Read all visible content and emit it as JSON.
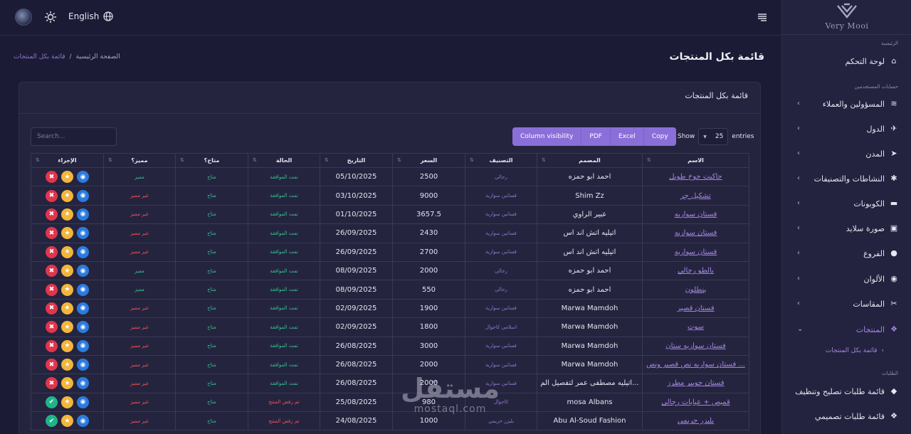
{
  "header": {
    "language": "English",
    "page_title": "قائمة بكل المنتجات",
    "breadcrumb": {
      "home": "الصفحة الرئيسية",
      "current": "قائمة بكل المنتجات",
      "separator": "/"
    }
  },
  "sidebar": {
    "logo_text": "Very Mooi",
    "sections": {
      "main": "الرئيسية",
      "users": "حسابات المستخدمين",
      "orders": "الطلبات"
    },
    "items": [
      {
        "label": "لوحة التحكم",
        "icon": "home-icon"
      },
      {
        "label": "المسؤولين والعملاء",
        "icon": "layers-icon"
      },
      {
        "label": "الدول",
        "icon": "plane-icon"
      },
      {
        "label": "المدن",
        "icon": "send-icon"
      },
      {
        "label": "النشاطات والتصنيفات",
        "icon": "gear-icon"
      },
      {
        "label": "الكوبونات",
        "icon": "ticket-icon"
      },
      {
        "label": "صورة سلايد",
        "icon": "image-icon"
      },
      {
        "label": "الفروع",
        "icon": "map-pin-icon"
      },
      {
        "label": "الألوان",
        "icon": "palette-icon"
      },
      {
        "label": "المقاسات",
        "icon": "scissors-icon"
      },
      {
        "label": "المنتجات",
        "icon": "cubes-icon"
      },
      {
        "label": "قائمة طلبات تصليح وتنظيف",
        "icon": "box-icon"
      },
      {
        "label": "قائمة طلبات تصميمي",
        "icon": "cubes-icon"
      }
    ],
    "sub_items": [
      {
        "label": "قائمة بكل المنتجات"
      }
    ]
  },
  "card": {
    "title": "قائمة بكل المنتجات",
    "search_placeholder": "Search...",
    "buttons": {
      "copy": "Copy",
      "excel": "Excel",
      "pdf": "PDF",
      "column_visibility": "Column visibility"
    },
    "show_label": "Show",
    "entries_label": "entries",
    "entries_value": "25"
  },
  "table": {
    "headers": {
      "actions": "الإجراء",
      "featured": "مميز؟",
      "available": "متاح؟",
      "status": "الحالة",
      "date": "التاريخ",
      "price": "السعر",
      "category": "التصنيف",
      "designer": "المصمم",
      "name": "الاسم"
    },
    "rows": [
      {
        "name": "جاكيت جوخ طويل",
        "designer": "احمد ابو حمزه",
        "category": "رجالي",
        "price": "2500",
        "date": "05/10/2025",
        "status": "تمت الموافقة",
        "available": "متاح",
        "featured": "مميز",
        "action": "delete"
      },
      {
        "name": "تشكيل جر",
        "designer": "Shim Zz",
        "category": "فساتين سوارية",
        "price": "9000",
        "date": "03/10/2025",
        "status": "تمت الموافقة",
        "available": "متاح",
        "featured": "غير مميز",
        "action": "delete"
      },
      {
        "name": "فستان سواريه",
        "designer": "عبير الراوي",
        "category": "فساتين سوارية",
        "price": "3657.5",
        "date": "01/10/2025",
        "status": "تمت الموافقة",
        "available": "متاح",
        "featured": "غير مميز",
        "action": "delete"
      },
      {
        "name": "فستان سواريه",
        "designer": "اتيليه اتش اند اس",
        "category": "فساتين سوارية",
        "price": "2430",
        "date": "26/09/2025",
        "status": "تمت الموافقة",
        "available": "متاح",
        "featured": "غير مميز",
        "action": "delete"
      },
      {
        "name": "فستان سواريه",
        "designer": "اتيليه اتش اند اس",
        "category": "فساتين سوارية",
        "price": "2700",
        "date": "26/09/2025",
        "status": "تمت الموافقة",
        "available": "متاح",
        "featured": "غير مميز",
        "action": "delete"
      },
      {
        "name": "بالطو رجالي",
        "designer": "احمد ابو حمزه",
        "category": "رجالي",
        "price": "2000",
        "date": "08/09/2025",
        "status": "تمت الموافقة",
        "available": "متاح",
        "featured": "مميز",
        "action": "delete"
      },
      {
        "name": "بنطلون",
        "designer": "احمد ابو حمزه",
        "category": "رجالي",
        "price": "550",
        "date": "08/09/2025",
        "status": "تمت الموافقة",
        "available": "متاح",
        "featured": "مميز",
        "action": "delete"
      },
      {
        "name": "فستان قصير",
        "designer": "Marwa Mamdoh",
        "category": "فساتين سوارية",
        "price": "1900",
        "date": "02/09/2025",
        "status": "تمت الموافقة",
        "available": "متاح",
        "featured": "غير مميز",
        "action": "delete"
      },
      {
        "name": "سوت",
        "designer": "Marwa Mamdoh",
        "category": "اسلامي   كاجوال",
        "price": "1800",
        "date": "02/09/2025",
        "status": "تمت الموافقة",
        "available": "متاح",
        "featured": "غير مميز",
        "action": "delete"
      },
      {
        "name": "فستان سواريه ستان",
        "designer": "Marwa Mamdoh",
        "category": "فساتين سوارية",
        "price": "3000",
        "date": "26/08/2025",
        "status": "تمت الموافقة",
        "available": "متاح",
        "featured": "غير مميز",
        "action": "delete"
      },
      {
        "name": "فستان سواريه نص قصير ونص ...",
        "designer": "Marwa Mamdoh",
        "category": "فساتين سوارية",
        "price": "2000",
        "date": "26/08/2025",
        "status": "تمت الموافقة",
        "available": "متاح",
        "featured": "غير مميز",
        "action": "delete"
      },
      {
        "name": "فستان جوبير مطرز",
        "designer": "اتيليه مصطفى عمر لتفصيل الم...",
        "category": "فساتين سوارية",
        "price": "2000",
        "date": "26/08/2025",
        "status": "تمت الموافقة",
        "available": "متاح",
        "featured": "غير مميز",
        "action": "delete"
      },
      {
        "name": "قميص + عبايات رجالي",
        "designer": "mosa Albans",
        "category": "كاجوال",
        "price": "980",
        "date": "25/08/2025",
        "status": "تم رفض المنتج",
        "available": "متاح",
        "featured": "غير مميز",
        "action": "approve"
      },
      {
        "name": "بليزر حريمي",
        "designer": "Abu Al-Soud Fashion",
        "category": "بليزر حريمي",
        "price": "1000",
        "date": "24/08/2025",
        "status": "تم رفض المنتج",
        "available": "متاح",
        "featured": "غير مميز",
        "action": "approve"
      }
    ]
  },
  "watermark": {
    "arabic": "مستقل",
    "latin": "mostaql.com"
  },
  "colors": {
    "accent": "#a486e0",
    "button": "#8b6fd8",
    "approved": "#34c38f",
    "rejected": "#f05656",
    "background": "#1c1b36"
  }
}
